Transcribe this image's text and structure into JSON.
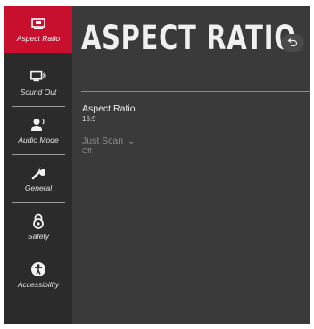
{
  "sidebar": {
    "items": [
      {
        "label": "Aspect Ratio",
        "icon": "aspect-ratio-icon",
        "active": true
      },
      {
        "label": "Sound Out",
        "icon": "tv-speaker-icon",
        "active": false
      },
      {
        "label": "Audio Mode",
        "icon": "person-audio-icon",
        "active": false
      },
      {
        "label": "General",
        "icon": "wrench-icon",
        "active": false
      },
      {
        "label": "Safety",
        "icon": "lock-icon",
        "active": false
      },
      {
        "label": "Accessibility",
        "icon": "accessibility-icon",
        "active": false
      }
    ]
  },
  "main": {
    "title": "ASPECT RATIO",
    "back_icon": "back-arrow-icon",
    "options": [
      {
        "name": "Aspect Ratio",
        "value": "16:9",
        "enabled": true
      },
      {
        "name": "Just Scan",
        "value": "Off",
        "enabled": false,
        "chevron": "⌄"
      }
    ]
  },
  "colors": {
    "accent": "#c8102e",
    "sidebar_bg": "#2c2b2b",
    "panel_bg": "#3a3a3a"
  }
}
